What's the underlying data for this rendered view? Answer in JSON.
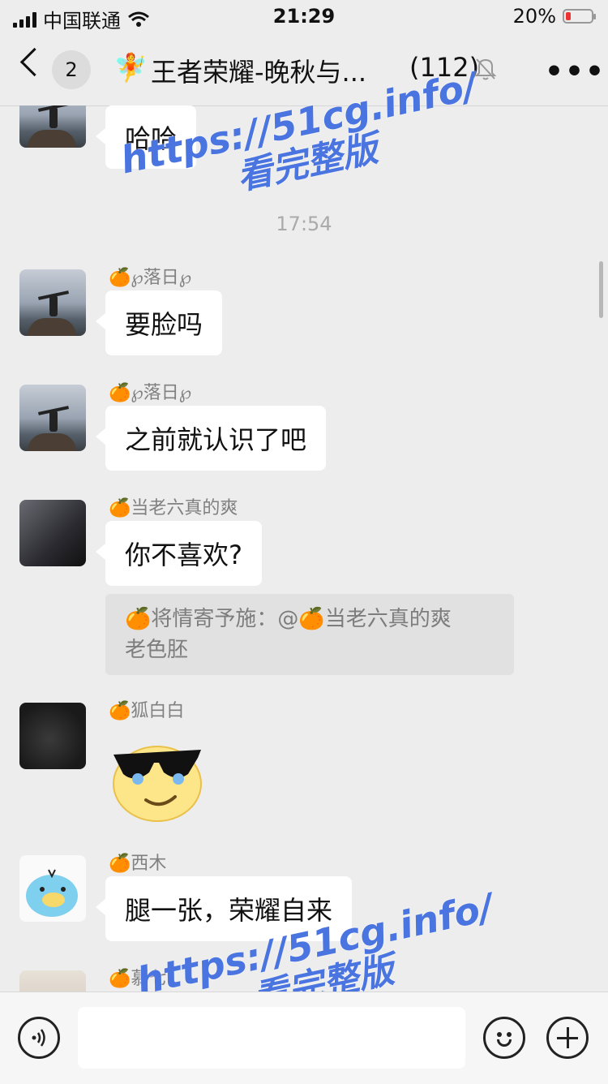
{
  "status_bar": {
    "carrier": "中国联通",
    "time": "21:29",
    "battery": "20%",
    "battery_level": 0.2
  },
  "nav": {
    "back_count": "2",
    "title": "王者荣耀-晚秋与...",
    "member_count": "(112)"
  },
  "messages": {
    "m1": {
      "text": "哈哈"
    },
    "timestamp": "17:54",
    "m2": {
      "sender": "🍊℘落日℘",
      "text": "要脸吗"
    },
    "m3": {
      "sender": "🍊℘落日℘",
      "text": "之前就认识了吧"
    },
    "m4": {
      "sender": "🍊当老六真的爽",
      "text": "你不喜欢?"
    },
    "quote": {
      "line1": "🍊将情寄予施：@🍊当老六真的爽",
      "line2": "老色胚"
    },
    "m5": {
      "sender": "🍊狐白白",
      "sticker": "cool-sunglasses-emoji"
    },
    "m6": {
      "sender": "🍊西木",
      "text": "腿一张，荣耀自来"
    },
    "m7": {
      "sender": "🍊慕七"
    }
  },
  "watermark": {
    "url": "https://51cg.info/",
    "text": "看完整版"
  },
  "input_bar": {
    "value": ""
  },
  "icons": {
    "group": "fairy-icon",
    "mute": "bell-off-icon",
    "more": "more-icon",
    "voice": "voice-icon",
    "emoji": "emoji-icon",
    "plus": "plus-icon"
  }
}
